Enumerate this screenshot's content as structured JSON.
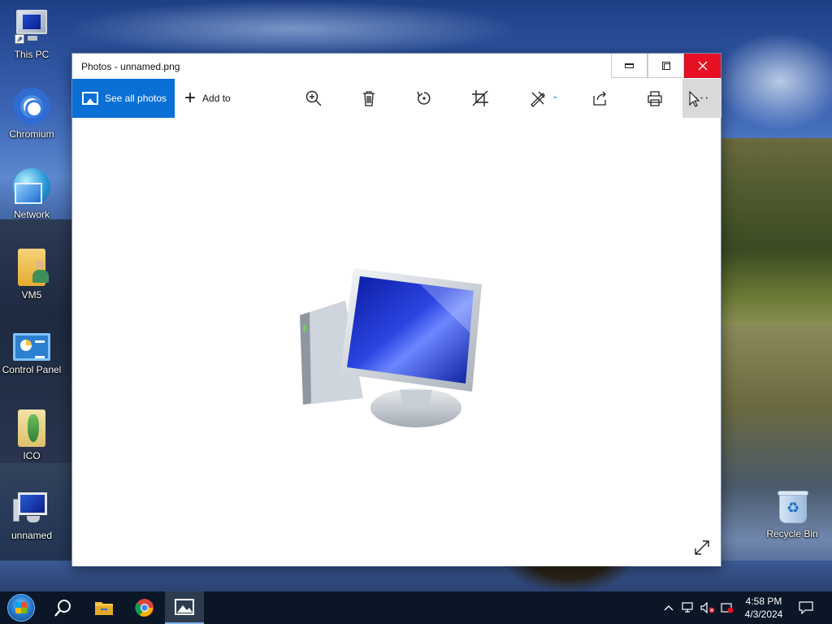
{
  "desktop": {
    "icons": [
      {
        "label": "This PC",
        "icon": "this-pc-icon"
      },
      {
        "label": "Chromium",
        "icon": "chromium-icon"
      },
      {
        "label": "Network",
        "icon": "network-icon"
      },
      {
        "label": "VM5",
        "icon": "user-folder-icon"
      },
      {
        "label": "Control Panel",
        "icon": "control-panel-icon"
      },
      {
        "label": "ICO",
        "icon": "folder-icon"
      },
      {
        "label": "unnamed",
        "icon": "computer-image-icon"
      },
      {
        "label": "Recycle Bin",
        "icon": "recycle-bin-icon"
      }
    ]
  },
  "window": {
    "title": "Photos - unnamed.png",
    "controls": {
      "minimize": "minimize-icon",
      "maximize": "restore-icon",
      "close": "close-icon"
    },
    "toolbar": {
      "see_all_photos": "See all photos",
      "add_to": "Add to",
      "tools": [
        "zoom-in-icon",
        "delete-icon",
        "rotate-icon",
        "crop-icon",
        "edit-icon",
        "share-icon",
        "print-icon"
      ],
      "more": "···"
    },
    "image": {
      "subject": "computer-illustration"
    }
  },
  "taskbar": {
    "items": [
      "start-icon",
      "search-icon",
      "file-explorer-icon",
      "chrome-icon",
      "photos-icon"
    ],
    "tray": [
      "chevron-up-icon",
      "network-icon",
      "volume-muted-icon",
      "action-icon"
    ],
    "time": "4:58 PM",
    "date": "4/3/2024",
    "notifications": "notification-icon"
  },
  "colors": {
    "accent": "#0a70d6",
    "close": "#e81123",
    "taskbar": "#0b1626"
  }
}
